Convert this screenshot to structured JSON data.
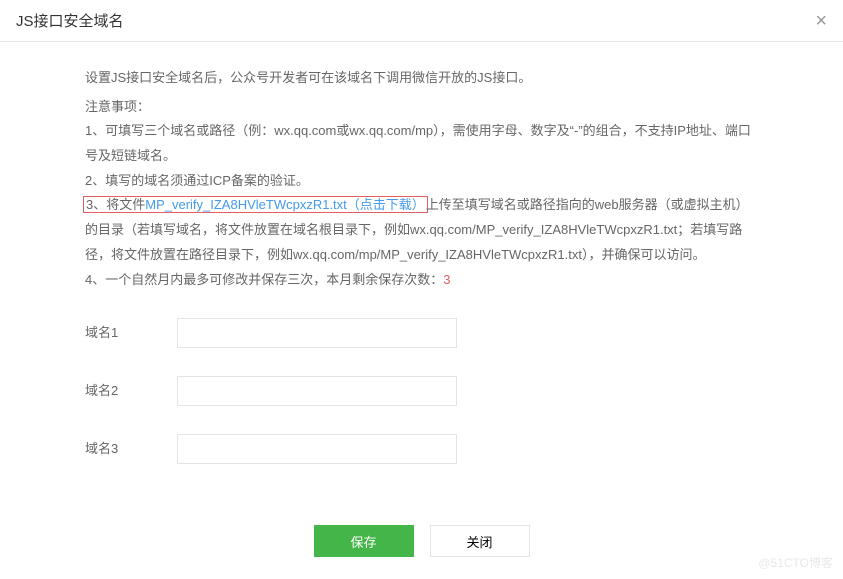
{
  "header": {
    "title": "JS接口安全域名"
  },
  "intro": "设置JS接口安全域名后，公众号开发者可在该域名下调用微信开放的JS接口。",
  "notes_title": "注意事项：",
  "notes": {
    "n1": "1、可填写三个域名或路径（例：wx.qq.com或wx.qq.com/mp），需使用字母、数字及“-”的组合，不支持IP地址、端口号及短链域名。",
    "n2": "2、填写的域名须通过ICP备案的验证。",
    "n3_pre": "3、将文件",
    "n3_link": "MP_verify_IZA8HVleTWcpxzR1.txt（点击下载）",
    "n3_post": "上传至填写域名或路径指向的web服务器（或虚拟主机）的目录（若填写域名，将文件放置在域名根目录下，例如wx.qq.com/MP_verify_IZA8HVleTWcpxzR1.txt；若填写路径，将文件放置在路径目录下，例如wx.qq.com/mp/MP_verify_IZA8HVleTWcpxzR1.txt），并确保可以访问。",
    "n4_pre": "4、一个自然月内最多可修改并保存三次，本月剩余保存次数：",
    "n4_count": "3"
  },
  "fields": [
    {
      "label": "域名1",
      "value": ""
    },
    {
      "label": "域名2",
      "value": ""
    },
    {
      "label": "域名3",
      "value": ""
    }
  ],
  "buttons": {
    "save": "保存",
    "close": "关闭"
  },
  "watermark": "@51CTO博客"
}
